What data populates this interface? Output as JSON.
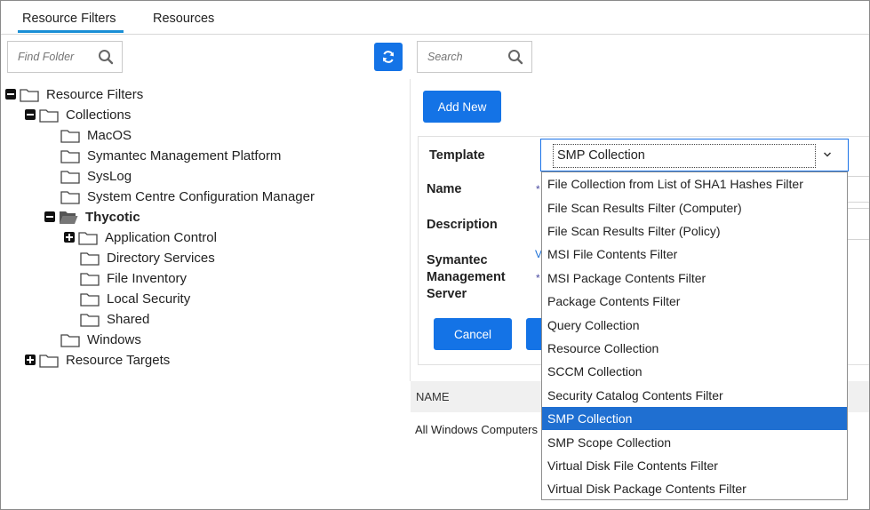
{
  "tabs": [
    {
      "label": "Resource Filters",
      "active": true
    },
    {
      "label": "Resources",
      "active": false
    }
  ],
  "left_panel": {
    "find_placeholder": "Find Folder",
    "tree": [
      {
        "label": "Resource Filters",
        "toggle": "minus",
        "icon": "folder",
        "bold": false
      },
      {
        "label": "Collections",
        "toggle": "minus",
        "icon": "folder",
        "bold": false
      },
      {
        "label": "MacOS",
        "toggle": "none",
        "icon": "folder",
        "bold": false
      },
      {
        "label": "Symantec Management Platform",
        "toggle": "none",
        "icon": "folder",
        "bold": false
      },
      {
        "label": "SysLog",
        "toggle": "none",
        "icon": "folder",
        "bold": false
      },
      {
        "label": "System Centre Configuration Manager",
        "toggle": "none",
        "icon": "folder",
        "bold": false
      },
      {
        "label": "Thycotic",
        "toggle": "minus",
        "icon": "folder-open",
        "bold": true
      },
      {
        "label": "Application Control",
        "toggle": "plus",
        "icon": "folder",
        "bold": false
      },
      {
        "label": "Directory Services",
        "toggle": "none",
        "icon": "folder",
        "bold": false
      },
      {
        "label": "File Inventory",
        "toggle": "none",
        "icon": "folder",
        "bold": false
      },
      {
        "label": "Local Security",
        "toggle": "none",
        "icon": "folder",
        "bold": false
      },
      {
        "label": "Shared",
        "toggle": "none",
        "icon": "folder",
        "bold": false
      },
      {
        "label": "Windows",
        "toggle": "none",
        "icon": "folder",
        "bold": false
      },
      {
        "label": "Resource Targets",
        "toggle": "plus",
        "icon": "folder",
        "bold": false
      }
    ]
  },
  "right_panel": {
    "search_placeholder": "Search",
    "add_new_label": "Add New",
    "form": {
      "template_label": "Template",
      "name_label": "Name",
      "description_label": "Description",
      "server_label": "Symantec Management Server",
      "required_mark": "*",
      "partial_link": "V",
      "cancel_label": "Cancel"
    },
    "select": {
      "value": "SMP Collection",
      "options": [
        "File Collection from List of SHA1 Hashes Filter",
        "File Scan Results Filter (Computer)",
        "File Scan Results Filter (Policy)",
        "MSI File Contents Filter",
        "MSI Package Contents Filter",
        "Package Contents Filter",
        "Query Collection",
        "Resource Collection",
        "SCCM Collection",
        "Security Catalog Contents Filter",
        "SMP Collection",
        "SMP Scope Collection",
        "Virtual Disk File Contents Filter",
        "Virtual Disk Package Contents Filter"
      ],
      "selected_index": 10
    },
    "table": {
      "header_name": "NAME",
      "first_row": "All Windows Computers"
    }
  },
  "colors": {
    "accent": "#1473e6",
    "tab_underline": "#1a8fd6",
    "selected_option": "#1f6fd1"
  }
}
